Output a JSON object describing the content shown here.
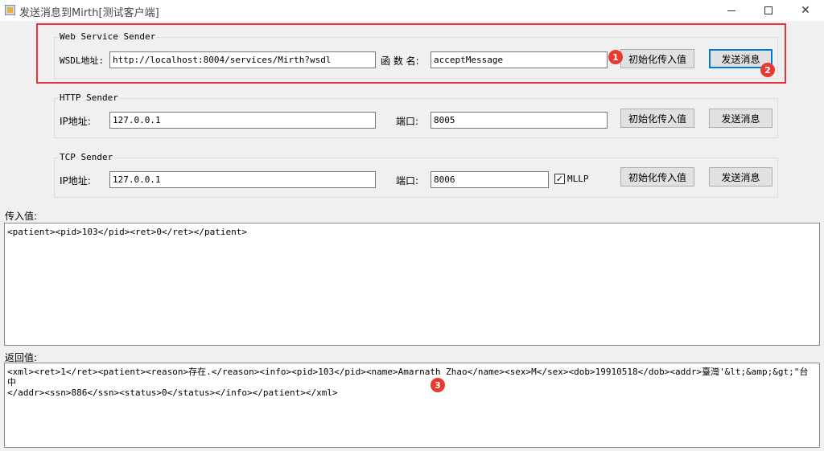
{
  "window": {
    "title": "发送消息到Mirth[测试客户端]",
    "minimize_icon": "minimize-icon",
    "maximize_icon": "maximize-icon",
    "close_icon": "close-icon",
    "close_glyph": "✕"
  },
  "web_sender": {
    "group_title": "Web  Service Sender",
    "wsdl_label": "WSDL地址:",
    "wsdl_value": "http://localhost:8004/services/Mirth?wsdl",
    "func_label": "函 数 名:",
    "func_value": "acceptMessage",
    "init_button": "初始化传入值",
    "send_button": "发送消息"
  },
  "http_sender": {
    "group_title": "HTTP Sender",
    "ip_label": "IP地址:",
    "ip_value": "127.0.0.1",
    "port_label": "端口:",
    "port_value": "8005",
    "init_button": "初始化传入值",
    "send_button": "发送消息"
  },
  "tcp_sender": {
    "group_title": "TCP Sender",
    "ip_label": "IP地址:",
    "ip_value": "127.0.0.1",
    "port_label": "端口:",
    "port_value": "8006",
    "mllp_label": "MLLP",
    "mllp_checked": true,
    "check_glyph": "✓",
    "init_button": "初始化传入值",
    "send_button": "发送消息"
  },
  "input_section": {
    "label": "传入值:",
    "value": "<patient><pid>103</pid><ret>0</ret></patient>"
  },
  "output_section": {
    "label": "返回值:",
    "value": "<xml><ret>1</ret><patient><reason>存在.</reason><info><pid>103</pid><name>Amarnath Zhao</name><sex>M</sex><dob>19910518</dob><addr>臺灣'&lt;&amp;&gt;\"台中\n</addr><ssn>886</ssn><status>0</status></info></patient></xml>"
  },
  "annotations": {
    "highlight_color": "#e8323c",
    "marker_1": "1",
    "marker_2": "2",
    "marker_3": "3"
  }
}
